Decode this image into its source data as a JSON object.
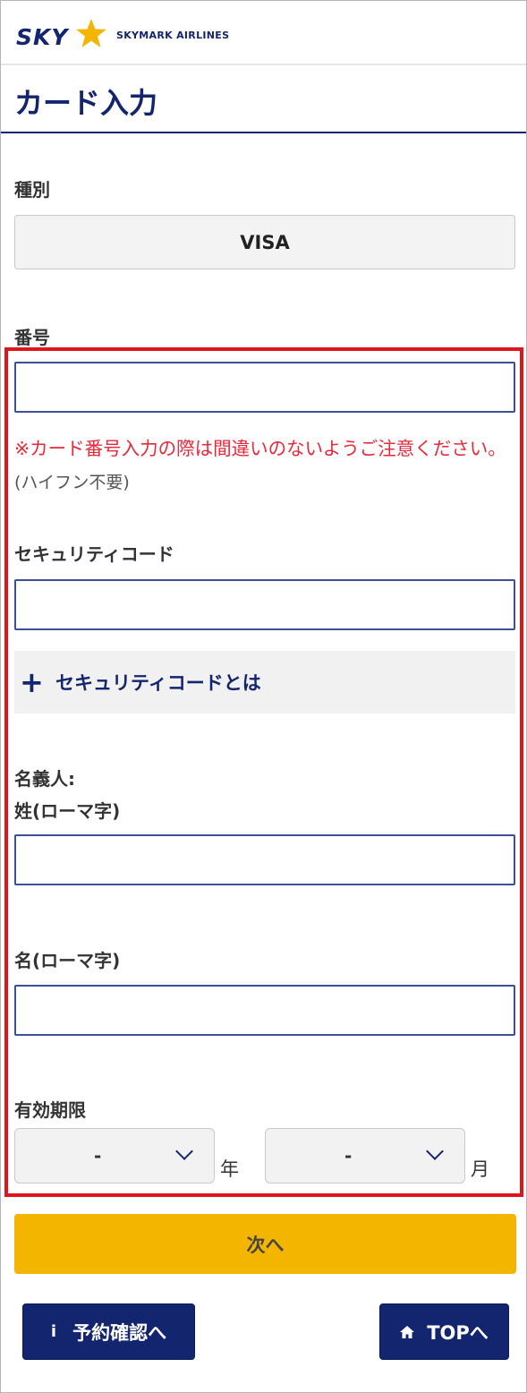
{
  "header": {
    "logo_sky": "SKY",
    "logo_text": "SKYMARK AIRLINES"
  },
  "page": {
    "title": "カード入力"
  },
  "form": {
    "type_label": "種別",
    "type_value": "VISA",
    "number_label": "番号",
    "number_warning": "※カード番号入力の際は間違いのないようご注意ください。",
    "number_note": "(ハイフン不要)",
    "security_label": "セキュリティコード",
    "security_toggle": "セキュリティコードとは",
    "name_label_line1": "名義人:",
    "name_label_line2": "姓(ローマ字)",
    "first_name_label": "名(ローマ字)",
    "expiry_label": "有効期限",
    "year_value": "-",
    "year_unit": "年",
    "month_value": "-",
    "month_unit": "月"
  },
  "actions": {
    "next_label": "次へ",
    "reservation_label": "予約確認へ",
    "top_label": "TOPへ"
  },
  "colors": {
    "brand_navy": "#14256f",
    "accent_yellow": "#f4b500",
    "warning_red": "#e8283a",
    "highlight_red": "#e0141c"
  },
  "icons": {
    "info": "info-icon",
    "home": "home-icon",
    "plus": "plus-icon",
    "chevron": "chevron-down-icon",
    "star": "star-logo-icon"
  }
}
